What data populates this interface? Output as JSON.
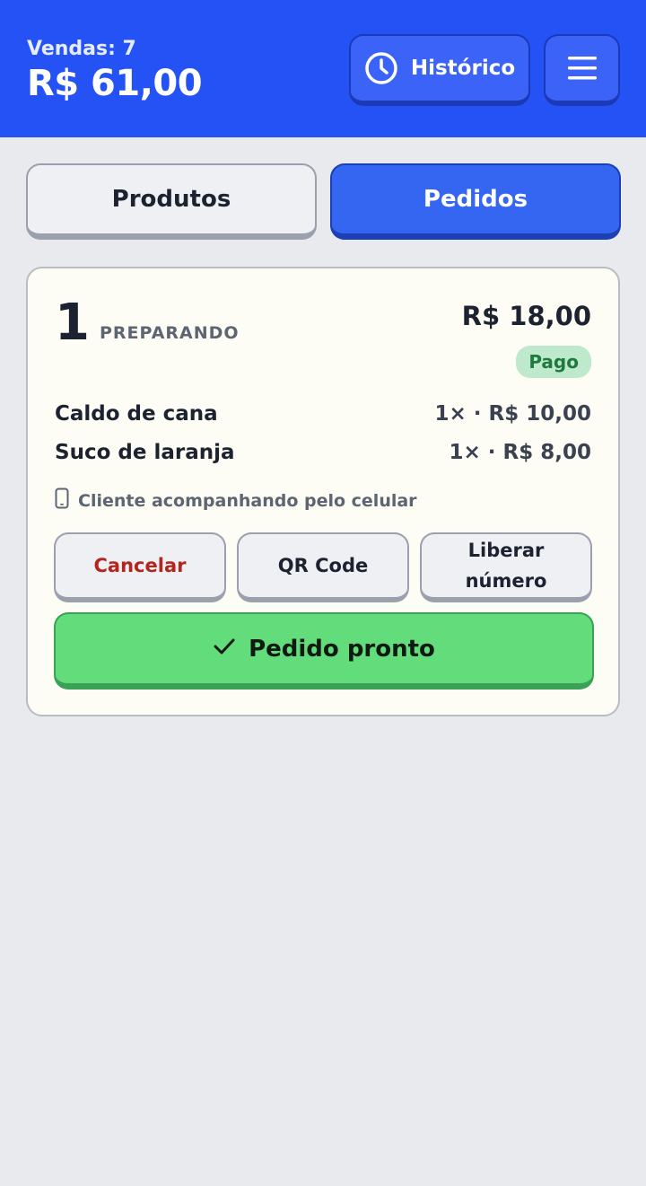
{
  "header": {
    "sales_count": "Vendas: 7",
    "sales_total": "R$ 61,00",
    "history_label": "Histórico",
    "history_icon": "clock-icon",
    "menu_icon": "hamburger-menu-icon",
    "accent_color": "#2552f5"
  },
  "tabs": [
    {
      "label": "Produtos",
      "active": false
    },
    {
      "label": "Pedidos",
      "active": true
    }
  ],
  "order": {
    "number": "1",
    "status": "PREPARANDO",
    "total": "R$ 18,00",
    "payment_badge": "Pago",
    "items": [
      {
        "name": "Caldo de cana",
        "qty_price": "1× · R$ 10,00"
      },
      {
        "name": "Suco de laranja",
        "qty_price": "1× · R$ 8,00"
      }
    ],
    "client_note": "Cliente acompanhando pelo celular",
    "client_note_icon": "phone-icon",
    "actions": {
      "cancel": "Cancelar",
      "qr_code": "QR Code",
      "release_line1": "Liberar",
      "release_line2": "número",
      "ready": "Pedido pronto",
      "ready_icon": "checkmark-icon"
    }
  }
}
